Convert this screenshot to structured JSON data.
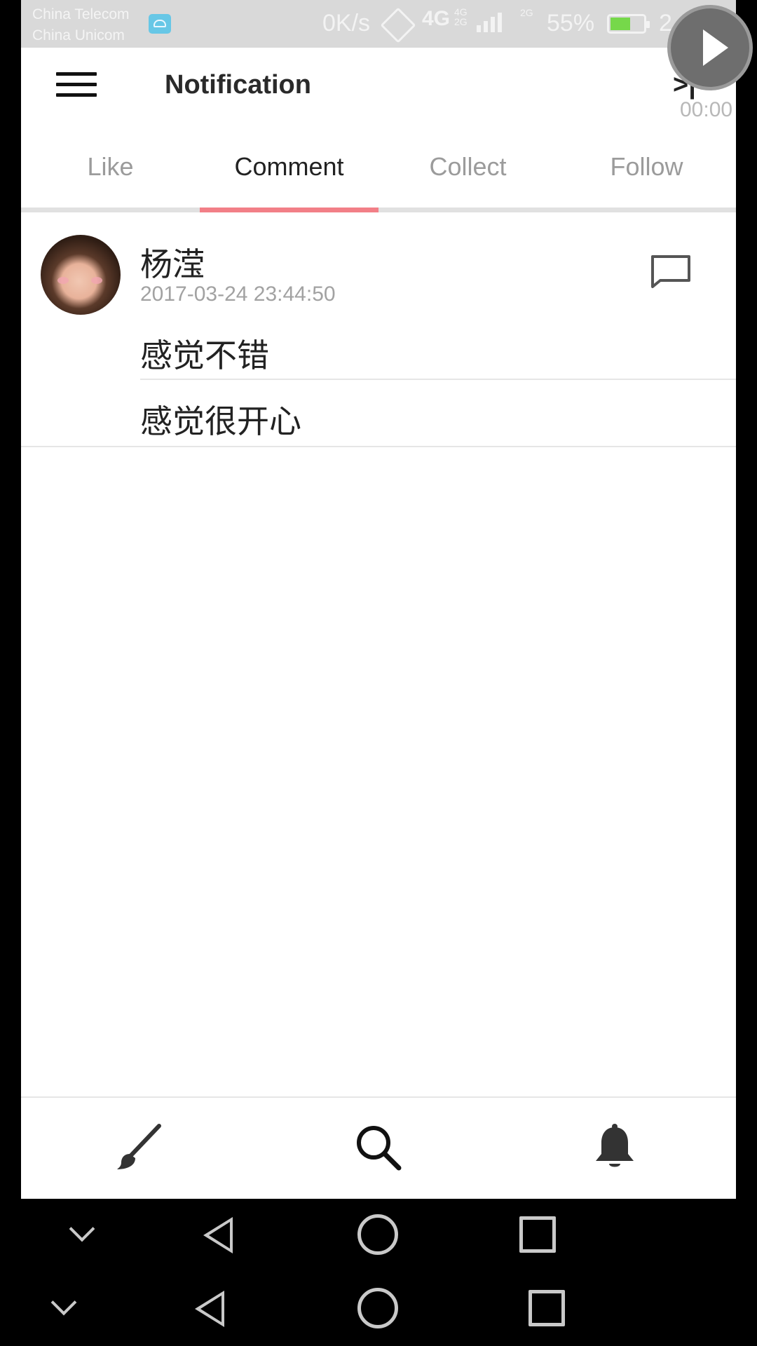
{
  "status_bar": {
    "carrier_1": "China Telecom",
    "carrier_2": "China Unicom",
    "net_speed": "0K/s",
    "network_4g": "4G",
    "network_small_top": "4G",
    "network_small_bottom": "2G",
    "network_2g": "2G",
    "battery_percent": "55%",
    "time_partial": "2"
  },
  "recording_overlay": {
    "elapsed": "00:00"
  },
  "header": {
    "title": "Notification",
    "skip_icon_glyph": ">|"
  },
  "tabs": [
    {
      "label": "Like",
      "active": false
    },
    {
      "label": "Comment",
      "active": true
    },
    {
      "label": "Collect",
      "active": false
    },
    {
      "label": "Follow",
      "active": false
    }
  ],
  "accent_color": "#f27f87",
  "notifications": [
    {
      "username": "杨滢",
      "timestamp": "2017-03-24 23:44:50",
      "comments": [
        "感觉不错",
        "感觉很开心"
      ],
      "icon": "comment-icon"
    }
  ],
  "bottom_nav": {
    "items": [
      "brush-icon",
      "search-icon",
      "bell-icon"
    ]
  },
  "system_nav": {
    "items": [
      "chevron-down-icon",
      "back-icon",
      "home-icon",
      "recent-apps-icon"
    ]
  }
}
